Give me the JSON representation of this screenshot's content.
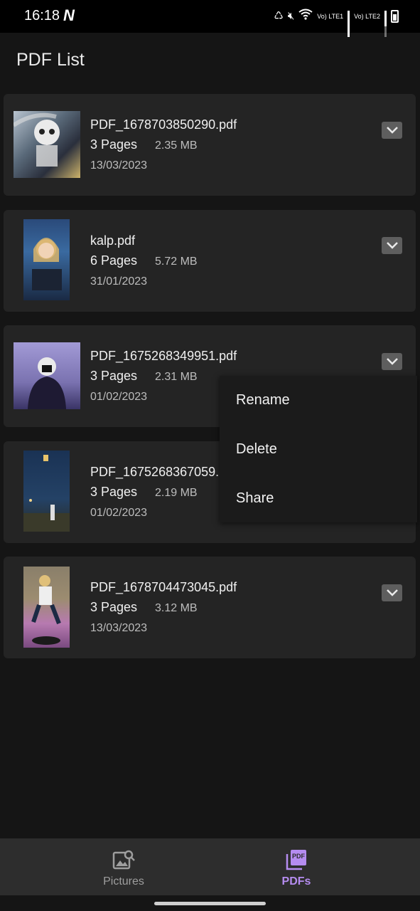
{
  "status_bar": {
    "time": "16:18",
    "nfc_glyph": "N",
    "sim1_label": "Vo) LTE1",
    "sim2_label": "Vo) LTE2"
  },
  "header": {
    "title": "PDF List"
  },
  "pdfs": [
    {
      "name": "PDF_1678703850290.pdf",
      "pages": "3 Pages",
      "size": "2.35 MB",
      "date": "13/03/2023"
    },
    {
      "name": "kalp.pdf",
      "pages": "6 Pages",
      "size": "5.72 MB",
      "date": "31/01/2023"
    },
    {
      "name": "PDF_1675268349951.pdf",
      "pages": "3 Pages",
      "size": "2.31 MB",
      "date": "01/02/2023"
    },
    {
      "name": "PDF_1675268367059.pdf",
      "pages": "3 Pages",
      "size": "2.19 MB",
      "date": "01/02/2023"
    },
    {
      "name": "PDF_1678704473045.pdf",
      "pages": "3 Pages",
      "size": "3.12 MB",
      "date": "13/03/2023"
    }
  ],
  "context_menu": {
    "items": [
      "Rename",
      "Delete",
      "Share"
    ]
  },
  "bottom_nav": {
    "pictures_label": "Pictures",
    "pdfs_label": "PDFs",
    "pdf_icon_text": "PDF",
    "active_color": "#b58cf0",
    "inactive_color": "#9e9e9e"
  }
}
